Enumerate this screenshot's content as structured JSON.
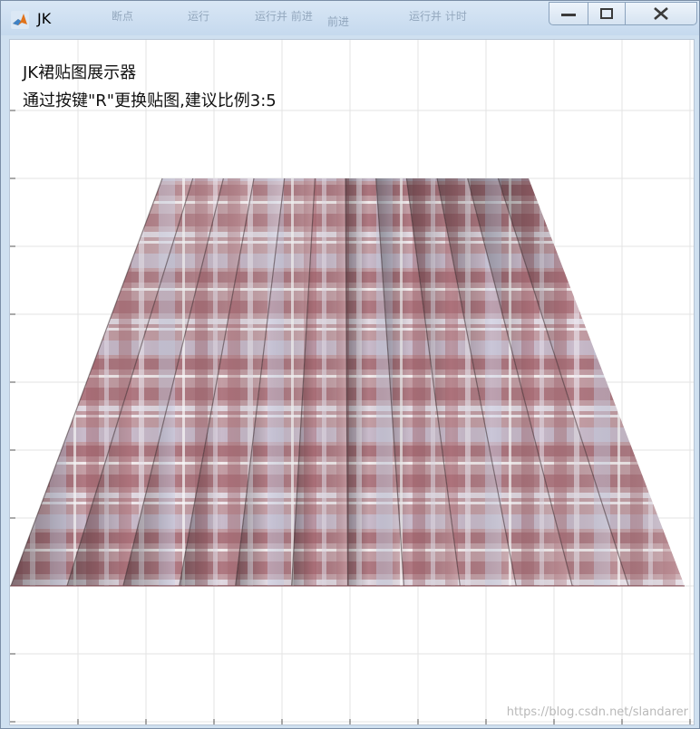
{
  "window": {
    "title": "JK"
  },
  "ribbon_ghost": [
    "断点",
    "运行",
    "运行并\n前进",
    "前进",
    "运行并\n计时"
  ],
  "figure": {
    "line1": "JK裙贴图展示器",
    "line2": "通过按键\"R\"更换贴图,建议比例3:5"
  },
  "watermark": "https://blog.csdn.net/slandarer",
  "colors": {
    "plaid_base": "#c19aa0",
    "plaid_dark": "#9e5c66",
    "plaid_light": "#e6e6f1",
    "plaid_blue": "#c8cfe8",
    "grid": "#e3e3e3"
  },
  "icons": {
    "app": "matlab-icon",
    "minimize": "minimize-icon",
    "maximize": "maximize-icon",
    "close": "close-icon"
  }
}
